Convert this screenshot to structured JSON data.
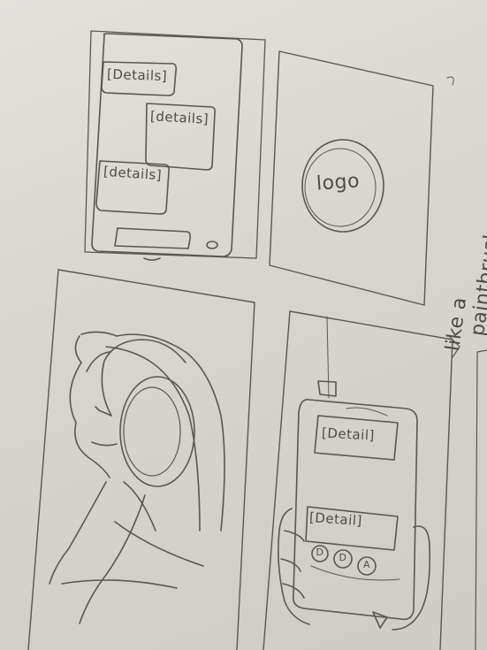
{
  "sketch": {
    "chat_panel": {
      "bubbles": [
        "[Details]",
        "[details]",
        "[details]"
      ]
    },
    "logo_panel": {
      "logo_text": "logo"
    },
    "phone_panel": {
      "top_detail": "[Detail]",
      "bottom_detail": "[Detail]",
      "buttons": [
        "D",
        "D",
        "A"
      ]
    },
    "side_note": {
      "line1": "like a",
      "line2": "paintbrush"
    }
  }
}
